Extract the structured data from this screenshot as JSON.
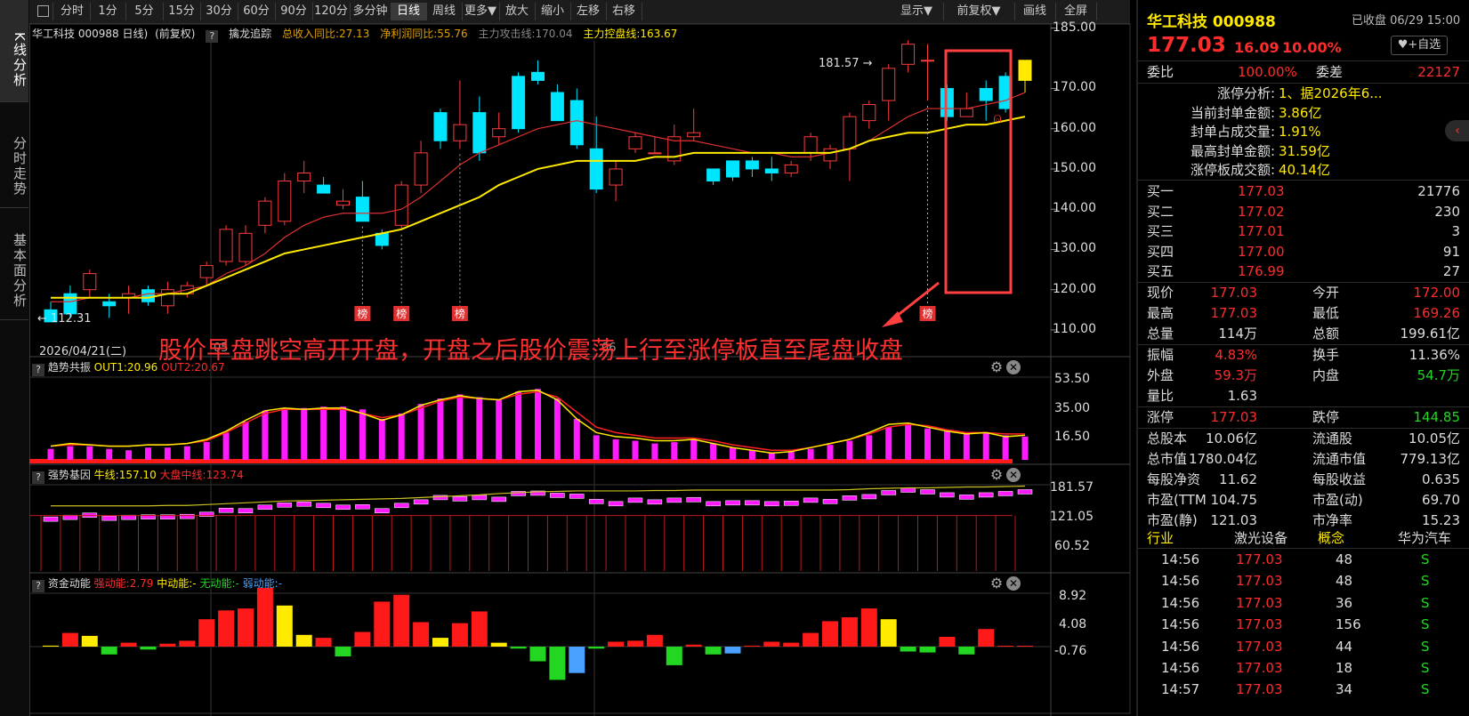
{
  "left_tabs": [
    "K线分析",
    "分时走势",
    "基本面分析"
  ],
  "toolbar": {
    "periods": [
      "分时",
      "1分",
      "5分",
      "15分",
      "30分",
      "60分",
      "90分",
      "120分",
      "多分钟",
      "日线",
      "周线",
      "更多▼",
      "放大",
      "缩小",
      "左移",
      "右移"
    ],
    "active": "日线",
    "right_items": [
      "显示▼",
      "前复权▼",
      "画线",
      "全屏"
    ]
  },
  "main_chart": {
    "title": "华工科技 000988 日线)",
    "adjust": "(前复权)",
    "indicator_name": "擒龙追踪",
    "indicators": [
      {
        "label": "总收入同比:27.13",
        "color": "#e0a000"
      },
      {
        "label": "净利润同比:55.76",
        "color": "#e0a000"
      },
      {
        "label": "主力攻击线:170.04",
        "color": "#888888"
      },
      {
        "label": "主力控盘线:163.67",
        "color": "#ffea00"
      }
    ],
    "y_axis": [
      "185.00",
      "170.00",
      "160.00",
      "150.00",
      "140.00",
      "130.00",
      "120.00",
      "110.00"
    ],
    "y_ticks": [
      185,
      170,
      160,
      150,
      140,
      130,
      120,
      110
    ],
    "high_label": "181.57",
    "low_label": "112.31",
    "date_label": "2026/04/21(二)",
    "month_labels": [
      "05",
      "06"
    ],
    "annotation": "股价早盘跳空高开开盘，开盘之后股价震荡上行至涨停板直至尾盘收盘",
    "bang_label": "榜",
    "candles": [
      [
        115,
        112,
        117,
        112
      ],
      [
        119,
        114,
        121,
        113
      ],
      [
        120,
        124,
        125,
        118
      ],
      [
        117,
        116,
        119,
        113
      ],
      [
        118,
        119,
        121,
        114
      ],
      [
        120,
        117,
        121,
        116
      ],
      [
        116,
        120,
        122,
        114
      ],
      [
        119,
        121,
        122,
        118
      ],
      [
        123,
        126,
        127,
        121
      ],
      [
        127,
        135,
        136,
        126
      ],
      [
        127,
        134,
        136,
        126
      ],
      [
        136,
        142,
        143,
        134
      ],
      [
        137,
        147,
        149,
        136
      ],
      [
        147,
        149,
        152,
        144
      ],
      [
        146,
        144,
        148,
        144
      ],
      [
        141,
        142,
        145,
        140
      ],
      [
        143,
        137,
        147,
        137
      ],
      [
        134,
        131,
        135,
        130
      ],
      [
        136,
        146,
        147,
        135
      ],
      [
        146,
        154,
        157,
        144
      ],
      [
        164,
        157,
        165,
        155
      ],
      [
        157,
        161,
        172,
        155
      ],
      [
        164,
        154,
        168,
        152
      ],
      [
        158,
        160,
        164,
        156
      ],
      [
        173,
        160,
        174,
        159
      ],
      [
        174,
        172,
        177,
        171
      ],
      [
        169,
        162,
        171,
        162
      ],
      [
        167,
        156,
        170,
        155
      ],
      [
        155,
        145,
        163,
        144
      ],
      [
        146,
        150,
        152,
        142
      ],
      [
        155,
        158,
        159,
        154
      ],
      [
        154,
        154,
        158,
        154
      ],
      [
        152,
        158,
        161,
        151
      ],
      [
        158,
        159,
        165,
        157
      ],
      [
        150,
        147,
        150,
        146
      ],
      [
        152,
        148,
        152,
        147
      ],
      [
        152,
        150,
        153,
        148
      ],
      [
        150,
        149,
        153,
        147
      ],
      [
        149,
        151,
        152,
        148
      ],
      [
        154,
        158,
        159,
        152
      ],
      [
        152,
        155,
        156,
        150
      ],
      [
        155,
        163,
        164,
        147
      ],
      [
        162,
        166,
        167,
        160
      ],
      [
        167,
        175,
        176,
        162
      ],
      [
        176,
        181,
        182,
        174
      ],
      [
        177,
        177,
        181,
        167
      ],
      [
        170,
        163,
        171,
        162
      ],
      [
        163,
        165,
        169,
        163
      ],
      [
        170,
        167,
        172,
        162
      ],
      [
        173,
        165,
        174,
        164
      ],
      [
        172,
        177,
        177,
        169
      ]
    ],
    "line_yellow": [
      118,
      118,
      118,
      118,
      118,
      118,
      119,
      119,
      121,
      123,
      125,
      127,
      129,
      130,
      131,
      132,
      133,
      134,
      135,
      137,
      139,
      141,
      143,
      146,
      148,
      150,
      151,
      152,
      152,
      152,
      152,
      153,
      153,
      154,
      154,
      154,
      154,
      154,
      154,
      154,
      154,
      155,
      157,
      158,
      159,
      159,
      160,
      161,
      161,
      162,
      163
    ],
    "line_red": [
      117,
      117,
      118,
      118,
      118,
      119,
      119,
      120,
      121,
      124,
      126,
      129,
      133,
      136,
      138,
      139,
      139,
      139,
      140,
      143,
      147,
      151,
      154,
      156,
      158,
      160,
      161,
      162,
      161,
      160,
      159,
      158,
      157,
      157,
      156,
      155,
      154,
      154,
      153,
      153,
      154,
      155,
      157,
      160,
      163,
      165,
      165,
      165,
      166,
      167,
      169
    ],
    "bang_positions": [
      16,
      18,
      21,
      45
    ]
  },
  "panel2": {
    "name": "趋势共振",
    "out1": "OUT1:20.96",
    "out2": "OUT2:20.67",
    "y_axis": [
      "53.50",
      "35.00",
      "16.50"
    ],
    "bars": [
      8,
      10,
      10,
      8,
      7,
      9,
      9,
      10,
      13,
      20,
      28,
      36,
      38,
      38,
      39,
      39,
      37,
      30,
      34,
      41,
      45,
      48,
      46,
      44,
      50,
      52,
      45,
      30,
      18,
      15,
      14,
      12,
      13,
      15,
      12,
      9,
      7,
      5,
      6,
      8,
      11,
      14,
      18,
      24,
      26,
      23,
      21,
      19,
      20,
      18,
      17
    ],
    "out1_line": [
      10,
      12,
      11,
      10,
      10,
      11,
      11,
      12,
      15,
      21,
      29,
      36,
      38,
      37,
      38,
      38,
      34,
      29,
      33,
      40,
      44,
      47,
      45,
      44,
      50,
      51,
      44,
      30,
      20,
      17,
      16,
      14,
      14,
      15,
      12,
      9,
      7,
      5,
      6,
      9,
      12,
      15,
      20,
      26,
      27,
      24,
      21,
      19,
      20,
      17,
      18
    ],
    "out2_line": [
      10,
      11,
      11,
      10,
      10,
      11,
      11,
      12,
      14,
      20,
      27,
      34,
      37,
      37,
      37,
      37,
      34,
      31,
      33,
      38,
      43,
      46,
      45,
      44,
      48,
      50,
      46,
      35,
      24,
      20,
      18,
      16,
      16,
      16,
      14,
      11,
      9,
      7,
      7,
      9,
      12,
      15,
      19,
      24,
      26,
      25,
      22,
      20,
      20,
      19,
      19
    ]
  },
  "panel3": {
    "name": "强势基因",
    "cow_line": "牛线:157.10",
    "market_line": "大盘中线:123.74",
    "y_axis": [
      "181.57",
      "121.05",
      "60.52"
    ]
  },
  "panel4": {
    "name": "资金动能",
    "strong": "强动能:2.79",
    "mid": "中动能:-",
    "none": "无动能:-",
    "weak": "弱动能:-",
    "y_axis": [
      "8.92",
      "4.08",
      "-0.76"
    ],
    "bars": [
      [
        0.1,
        "#ffea00"
      ],
      [
        1.4,
        "#ff1a1a"
      ],
      [
        1.1,
        "#ffea00"
      ],
      [
        -0.8,
        "#22d622"
      ],
      [
        0.4,
        "#ff1a1a"
      ],
      [
        -0.3,
        "#22d622"
      ],
      [
        0.3,
        "#ff1a1a"
      ],
      [
        0.6,
        "#ff1a1a"
      ],
      [
        2.8,
        "#ff1a1a"
      ],
      [
        3.7,
        "#ff1a1a"
      ],
      [
        3.9,
        "#ff1a1a"
      ],
      [
        6.0,
        "#ff1a1a"
      ],
      [
        4.2,
        "#ffea00"
      ],
      [
        1.2,
        "#ffea00"
      ],
      [
        0.9,
        "#ff1a1a"
      ],
      [
        -1.0,
        "#22d622"
      ],
      [
        1.5,
        "#ff1a1a"
      ],
      [
        4.6,
        "#ff1a1a"
      ],
      [
        5.3,
        "#ff1a1a"
      ],
      [
        2.5,
        "#ff1a1a"
      ],
      [
        0.9,
        "#ffea00"
      ],
      [
        2.4,
        "#ff1a1a"
      ],
      [
        3.6,
        "#ff1a1a"
      ],
      [
        0.4,
        "#ffea00"
      ],
      [
        -0.2,
        "#22d622"
      ],
      [
        -1.5,
        "#22d622"
      ],
      [
        -3.4,
        "#22d622"
      ],
      [
        -2.7,
        "#4aa0ff"
      ],
      [
        -0.2,
        "#22d622"
      ],
      [
        0.5,
        "#ff1a1a"
      ],
      [
        0.6,
        "#ff1a1a"
      ],
      [
        1.2,
        "#ff1a1a"
      ],
      [
        -1.9,
        "#22d622"
      ],
      [
        0.2,
        "#ff1a1a"
      ],
      [
        -0.8,
        "#22d622"
      ],
      [
        -0.7,
        "#4aa0ff"
      ],
      [
        0.1,
        "#ff1a1a"
      ],
      [
        0.5,
        "#ff1a1a"
      ],
      [
        0.4,
        "#ff1a1a"
      ],
      [
        1.4,
        "#ff1a1a"
      ],
      [
        2.6,
        "#ff1a1a"
      ],
      [
        3.0,
        "#ff1a1a"
      ],
      [
        3.9,
        "#ff1a1a"
      ],
      [
        2.8,
        "#ffea00"
      ],
      [
        -0.5,
        "#22d622"
      ],
      [
        -0.6,
        "#22d622"
      ],
      [
        1.0,
        "#ff1a1a"
      ],
      [
        -0.8,
        "#22d622"
      ],
      [
        1.8,
        "#ff1a1a"
      ],
      [
        0.0,
        "#ff1a1a"
      ],
      [
        0.0,
        "#ff1a1a"
      ]
    ]
  },
  "quote": {
    "name": "华工科技 000988",
    "status": "已收盘 06/29 15:00",
    "price": "177.03",
    "change": "16.09",
    "pct": "10.00%",
    "watch": "+自选",
    "weibi_label": "委比",
    "weibi": "100.00%",
    "weicha_label": "委差",
    "weicha": "22127",
    "limit_info": [
      {
        "label": "涨停分析:",
        "value": "1、据2026年6..."
      },
      {
        "label": "当前封单金额:",
        "value": "3.86亿"
      },
      {
        "label": "封单占成交量:",
        "value": "1.91%"
      },
      {
        "label": "最高封单金额:",
        "value": "31.59亿"
      },
      {
        "label": "涨停板成交额:",
        "value": "40.14亿"
      }
    ],
    "bids": [
      {
        "label": "买一",
        "price": "177.03",
        "vol": "21776"
      },
      {
        "label": "买二",
        "price": "177.02",
        "vol": "230"
      },
      {
        "label": "买三",
        "price": "177.01",
        "vol": "3"
      },
      {
        "label": "买四",
        "price": "177.00",
        "vol": "91"
      },
      {
        "label": "买五",
        "price": "176.99",
        "vol": "27"
      }
    ],
    "stats": [
      {
        "l1": "现价",
        "v1": "177.03",
        "c1": "red",
        "l2": "今开",
        "v2": "172.00",
        "c2": "red"
      },
      {
        "l1": "最高",
        "v1": "177.03",
        "c1": "red",
        "l2": "最低",
        "v2": "169.26",
        "c2": "red"
      },
      {
        "l1": "总量",
        "v1": "114万",
        "c1": "white",
        "l2": "总额",
        "v2": "199.61亿",
        "c2": "white"
      },
      {
        "l1": "振幅",
        "v1": "4.83%",
        "c1": "red",
        "l2": "换手",
        "v2": "11.36%",
        "c2": "white"
      },
      {
        "l1": "外盘",
        "v1": "59.3万",
        "c1": "red",
        "l2": "内盘",
        "v2": "54.7万",
        "c2": "green"
      },
      {
        "l1": "量比",
        "v1": "1.63",
        "c1": "white",
        "l2": "",
        "v2": "",
        "c2": "white"
      },
      {
        "l1": "涨停",
        "v1": "177.03",
        "c1": "red",
        "l2": "跌停",
        "v2": "144.85",
        "c2": "green"
      },
      {
        "l1": "总股本",
        "v1": "10.06亿",
        "c1": "white",
        "l2": "流通股",
        "v2": "10.05亿",
        "c2": "white"
      },
      {
        "l1": "总市值",
        "v1": "1780.04亿",
        "c1": "white",
        "l2": "流通市值",
        "v2": "779.13亿",
        "c2": "white"
      },
      {
        "l1": "每股净资",
        "v1": "11.62",
        "c1": "white",
        "l2": "每股收益",
        "v2": "0.635",
        "c2": "white"
      },
      {
        "l1": "市盈(TTM",
        "v1": "104.75",
        "c1": "white",
        "l2": "市盈(动)",
        "v2": "69.70",
        "c2": "white"
      },
      {
        "l1": "市盈(静)",
        "v1": "121.03",
        "c1": "white",
        "l2": "市净率",
        "v2": "15.23",
        "c2": "white"
      }
    ],
    "industry_label": "行业",
    "industry": "激光设备",
    "concept_label": "概念",
    "concept": "华为汽车",
    "ticks": [
      {
        "time": "14:56",
        "price": "177.03",
        "vol": "48",
        "bs": "S"
      },
      {
        "time": "14:56",
        "price": "177.03",
        "vol": "48",
        "bs": "S"
      },
      {
        "time": "14:56",
        "price": "177.03",
        "vol": "36",
        "bs": "S"
      },
      {
        "time": "14:56",
        "price": "177.03",
        "vol": "156",
        "bs": "S"
      },
      {
        "time": "14:56",
        "price": "177.03",
        "vol": "44",
        "bs": "S"
      },
      {
        "time": "14:56",
        "price": "177.03",
        "vol": "18",
        "bs": "S"
      },
      {
        "time": "14:57",
        "price": "177.03",
        "vol": "34",
        "bs": "S"
      }
    ]
  }
}
